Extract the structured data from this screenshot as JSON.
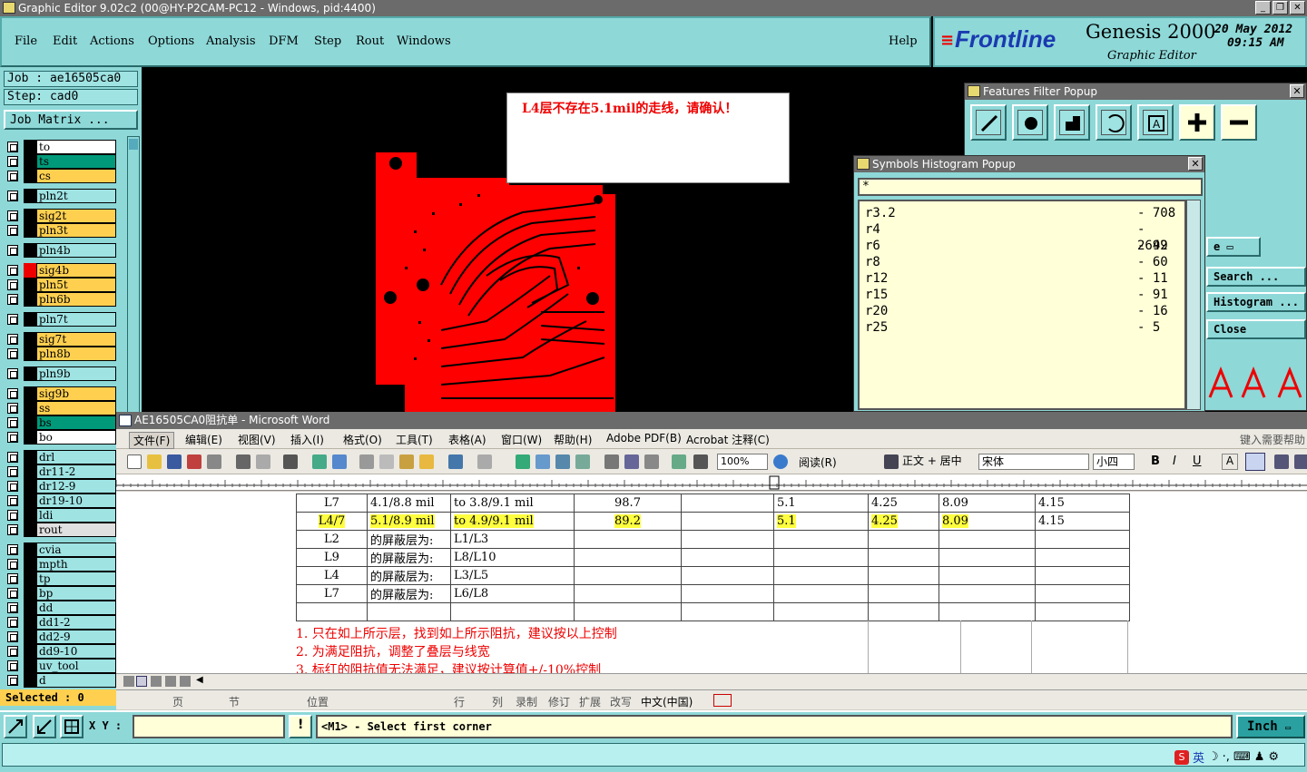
{
  "window": {
    "title": "Graphic Editor 9.02c2 (00@HY-P2CAM-PC12 - Windows, pid:4400)"
  },
  "menu": [
    "File",
    "Edit",
    "Actions",
    "Options",
    "Analysis",
    "DFM",
    "Step",
    "Rout",
    "Windows"
  ],
  "help_label": "Help",
  "brand": {
    "logo": "Frontline",
    "product": "Genesis 2000",
    "subtitle": "Graphic Editor",
    "date": "20 May 2012",
    "time": "09:15 AM"
  },
  "job": {
    "job": "Job : ae16505ca0",
    "step": "Step: cad0",
    "matrix_button": "Job Matrix ..."
  },
  "layers": [
    {
      "name": "to",
      "color": "#ffffff",
      "group": 0
    },
    {
      "name": "ts",
      "color": "#009a7a",
      "group": 0
    },
    {
      "name": "cs",
      "color": "#ffd050",
      "group": 0
    },
    {
      "name": "pln2t",
      "color": "#9fe3e3",
      "group": 1
    },
    {
      "name": "sig2t",
      "color": "#ffd050",
      "group": 2
    },
    {
      "name": "pln3t",
      "color": "#ffd050",
      "group": 2
    },
    {
      "name": "pln4b",
      "color": "#9fe3e3",
      "group": 3
    },
    {
      "name": "sig4b",
      "color": "#ffd050",
      "group": 4
    },
    {
      "name": "pln5t",
      "color": "#ffd050",
      "group": 4
    },
    {
      "name": "pln6b",
      "color": "#ffd050",
      "group": 4
    },
    {
      "name": "pln7t",
      "color": "#9fe3e3",
      "group": 5
    },
    {
      "name": "sig7t",
      "color": "#ffd050",
      "group": 6
    },
    {
      "name": "pln8b",
      "color": "#ffd050",
      "group": 6
    },
    {
      "name": "pln9b",
      "color": "#9fe3e3",
      "group": 7
    },
    {
      "name": "sig9b",
      "color": "#ffd050",
      "group": 8
    },
    {
      "name": "ss",
      "color": "#ffd050",
      "group": 8
    },
    {
      "name": "bs",
      "color": "#009a7a",
      "group": 8
    },
    {
      "name": "bo",
      "color": "#ffffff",
      "group": 8
    },
    {
      "name": "drl",
      "color": "#9fe3e3",
      "group": 9
    },
    {
      "name": "dr11-2",
      "color": "#9fe3e3",
      "group": 9
    },
    {
      "name": "dr12-9",
      "color": "#9fe3e3",
      "group": 9
    },
    {
      "name": "dr19-10",
      "color": "#9fe3e3",
      "group": 9
    },
    {
      "name": "ldi",
      "color": "#9fe3e3",
      "group": 9
    },
    {
      "name": "rout",
      "color": "#e0e0e0",
      "group": 9
    },
    {
      "name": "cvia",
      "color": "#9fe3e3",
      "group": 10
    },
    {
      "name": "mpth",
      "color": "#9fe3e3",
      "group": 10
    },
    {
      "name": "tp",
      "color": "#9fe3e3",
      "group": 10
    },
    {
      "name": "bp",
      "color": "#9fe3e3",
      "group": 10
    },
    {
      "name": "dd",
      "color": "#9fe3e3",
      "group": 10
    },
    {
      "name": "dd1-2",
      "color": "#9fe3e3",
      "group": 10
    },
    {
      "name": "dd2-9",
      "color": "#9fe3e3",
      "group": 10
    },
    {
      "name": "dd9-10",
      "color": "#9fe3e3",
      "group": 10
    },
    {
      "name": "uv_tool",
      "color": "#9fe3e3",
      "group": 10
    },
    {
      "name": "d",
      "color": "#9fe3e3",
      "group": 10
    }
  ],
  "selected": "Selected : 0",
  "message": "L4层不存在5.1mil的走线，请确认！",
  "features_filter": {
    "title": "Features Filter Popup",
    "buttons": [
      "Search ...",
      "Histogram ...",
      "Close"
    ]
  },
  "histogram": {
    "title": "Symbols Histogram Popup",
    "filter": "*",
    "rows": [
      {
        "symbol": "r3.2",
        "count": "- 708"
      },
      {
        "symbol": "r4",
        "count": "- 2642"
      },
      {
        "symbol": "r6",
        "count": "- 99"
      },
      {
        "symbol": "r8",
        "count": "- 60"
      },
      {
        "symbol": "r12",
        "count": "- 11"
      },
      {
        "symbol": "r15",
        "count": "- 91"
      },
      {
        "symbol": "r20",
        "count": "- 16"
      },
      {
        "symbol": "r25",
        "count": "- 5"
      }
    ]
  },
  "word": {
    "title": "AE16505CA0阻抗单 - Microsoft Word",
    "help_hint": "键入需要帮助",
    "menu": [
      "文件(F)",
      "编辑(E)",
      "视图(V)",
      "插入(I)",
      "格式(O)",
      "工具(T)",
      "表格(A)",
      "窗口(W)",
      "帮助(H)",
      "Adobe PDF(B)",
      "Acrobat 注释(C)"
    ],
    "zoom": "100%",
    "read_label": "阅读(R)",
    "style": "正文 + 居中",
    "font": "宋体",
    "size": "小四",
    "table_rows": [
      {
        "c1": "L7",
        "c2": "4.1/8.8 mil",
        "c3": "to 3.8/9.1 mil",
        "c4": "98.7",
        "c5": "",
        "c6": "5.1",
        "c7": "4.25",
        "c8": "8.09",
        "c9": "4.15",
        "hl": false
      },
      {
        "c1": "L4/7",
        "c2": "5.1/8.9 mil",
        "c3": "to 4.9/9.1 mil",
        "c4": "89.2",
        "c5": "",
        "c6": "5.1",
        "c7": "4.25",
        "c8": "8.09",
        "c9": "4.15",
        "hl": true
      },
      {
        "c1": "L2",
        "c2": "的屏蔽层为:",
        "c3": "L1/L3",
        "c4": "",
        "c5": "",
        "c6": "",
        "c7": "",
        "c8": "",
        "c9": "",
        "hl": false
      },
      {
        "c1": "L9",
        "c2": "的屏蔽层为:",
        "c3": "L8/L10",
        "c4": "",
        "c5": "",
        "c6": "",
        "c7": "",
        "c8": "",
        "c9": "",
        "hl": false
      },
      {
        "c1": "L4",
        "c2": "的屏蔽层为:",
        "c3": "L3/L5",
        "c4": "",
        "c5": "",
        "c6": "",
        "c7": "",
        "c8": "",
        "c9": "",
        "hl": false
      },
      {
        "c1": "L7",
        "c2": "的屏蔽层为:",
        "c3": "L6/L8",
        "c4": "",
        "c5": "",
        "c6": "",
        "c7": "",
        "c8": "",
        "c9": "",
        "hl": false
      }
    ],
    "notes": [
      "1. 只在如上所示层，找到如上所示阻抗，建议按以上控制",
      "2. 为满足阻抗，调整了叠层与线宽",
      "3. 标红的阻抗值无法满足，建议按计算值+/-10%控制"
    ],
    "status": [
      "页",
      "节",
      "位置",
      "行",
      "列",
      "录制",
      "修订",
      "扩展",
      "改写",
      "中文(中国)"
    ]
  },
  "command": {
    "xy_label": "X Y :",
    "prompt": "<M1> - Select first corner",
    "units": "Inch"
  },
  "tray": "英"
}
